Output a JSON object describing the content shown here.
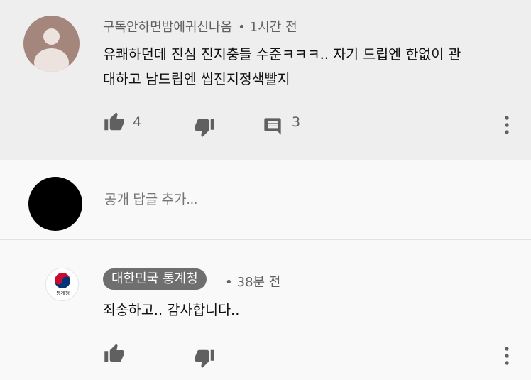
{
  "top_comment": {
    "author": "구독안하면밤에귀신나옴",
    "separator": "•",
    "time": "1시간 전",
    "text_line1": "유쾌하던데 진심 진지충들 수준ㅋㅋㅋ.. 자기 드립엔 한없이 관",
    "text_line2": "대하고 남드립엔 씹진지정색빨지",
    "like_count": "4",
    "reply_count": "3",
    "icons": [
      "thumb-up-icon",
      "thumb-down-icon",
      "reply-icon",
      "more-vert-icon"
    ]
  },
  "reply_box": {
    "placeholder": "공개 답글 추가..."
  },
  "reply": {
    "author": "대한민국 통계청",
    "separator": "•",
    "time": "38분 전",
    "text": "죄송하고.. 감사합니다..",
    "avatar_label": "통계청",
    "icons": [
      "thumb-up-icon",
      "thumb-down-icon",
      "more-vert-icon"
    ]
  },
  "colors": {
    "top_background": "#eeeeee",
    "page_background": "#f9f9f9",
    "chip_background": "#6f6f6f",
    "secondary_text": "#606060",
    "icon_color": "#606060"
  }
}
